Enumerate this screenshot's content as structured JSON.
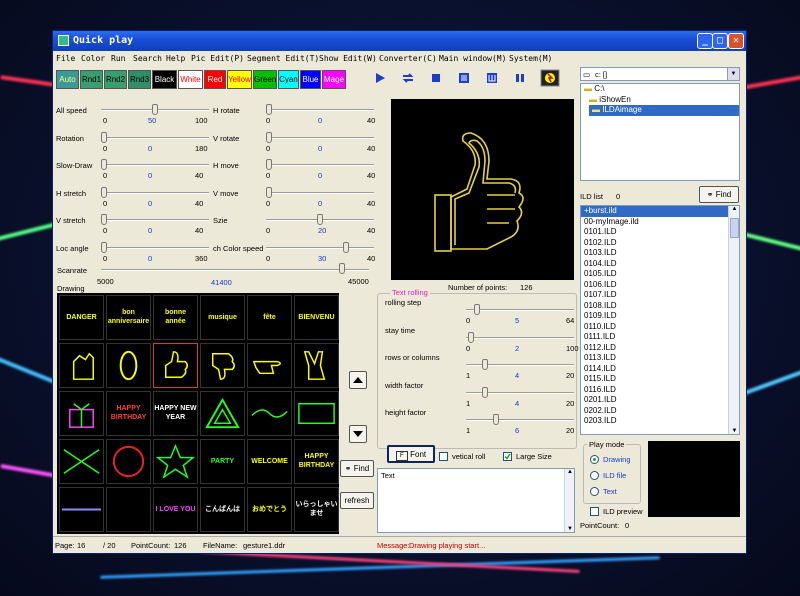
{
  "window": {
    "title": "Quick play"
  },
  "menu": [
    "File",
    "Color",
    "Run",
    "Search",
    "Help",
    "Pic Edit(P)",
    "Segment Edit(T)",
    "Show Edit(W)",
    "Converter(C)",
    "Main window(M)",
    "System(M)"
  ],
  "color_buttons": [
    {
      "label": "Auto",
      "bg": "#3a9a9a",
      "fg": "#ffff80"
    },
    {
      "label": "Rnd1",
      "bg": "#38a070",
      "fg": "#000000"
    },
    {
      "label": "Rnd2",
      "bg": "#38a070",
      "fg": "#000000"
    },
    {
      "label": "Rnd3",
      "bg": "#2f8f6a",
      "fg": "#000000"
    },
    {
      "label": "Black",
      "bg": "#000000",
      "fg": "#ffffff"
    },
    {
      "label": "White",
      "bg": "#ffffff",
      "fg": "#ff0000"
    },
    {
      "label": "Red",
      "bg": "#ff0000",
      "fg": "#ffffff"
    },
    {
      "label": "Yellow",
      "bg": "#ffff00",
      "fg": "#ff0000"
    },
    {
      "label": "Green",
      "bg": "#00c000",
      "fg": "#000000"
    },
    {
      "label": "Cyan",
      "bg": "#00ffff",
      "fg": "#000000"
    },
    {
      "label": "Blue",
      "bg": "#0000ff",
      "fg": "#ffffff"
    },
    {
      "label": "Mage",
      "bg": "#ff00ff",
      "fg": "#ffffff"
    }
  ],
  "toolbar_icons": [
    "play-icon",
    "loop-icon",
    "stop-icon",
    "segment-icon",
    "show-icon",
    "pause-icon",
    "power-icon"
  ],
  "left_sliders": [
    {
      "label": "All speed",
      "min": "0",
      "value": "50",
      "max": "100",
      "pos": 0.5
    },
    {
      "label": "Rotation",
      "min": "0",
      "value": "0",
      "max": "180",
      "pos": 0.0
    },
    {
      "label": "Slow-Draw",
      "min": "0",
      "value": "0",
      "max": "40",
      "pos": 0.0
    },
    {
      "label": "H stretch",
      "min": "0",
      "value": "0",
      "max": "40",
      "pos": 0.0
    },
    {
      "label": "V stretch",
      "min": "0",
      "value": "0",
      "max": "40",
      "pos": 0.0
    },
    {
      "label": "Loc angle",
      "min": "0",
      "value": "0",
      "max": "360",
      "pos": 0.0
    }
  ],
  "right_sliders": [
    {
      "label": "H rotate",
      "min": "0",
      "value": "0",
      "max": "40",
      "pos": 0.0
    },
    {
      "label": "V rotate",
      "min": "0",
      "value": "0",
      "max": "40",
      "pos": 0.0
    },
    {
      "label": "H move",
      "min": "0",
      "value": "0",
      "max": "40",
      "pos": 0.0
    },
    {
      "label": "V move",
      "min": "0",
      "value": "0",
      "max": "40",
      "pos": 0.0
    },
    {
      "label": "Szie",
      "min": "0",
      "value": "20",
      "max": "40",
      "pos": 0.5
    },
    {
      "label": "ch Color speed",
      "min": "0",
      "value": "30",
      "max": "40",
      "pos": 0.75
    }
  ],
  "scanrate": {
    "label": "Scanrate",
    "min": "5000",
    "value": "41400",
    "max": "45000",
    "pos": 0.91
  },
  "drawing_label": "Drawing",
  "thumbnails": [
    "DANGER",
    "bon anniversaire",
    "bonne année",
    "musique",
    "fête",
    "BIENVENU",
    "hand-icon",
    "zero-icon",
    "thumbs-up-icon",
    "thumbs-down-icon",
    "pointing-hand-icon",
    "victory-hand-icon",
    "gift-icon",
    "HAPPY BIRTHDAY",
    "HAPPY NEW YEAR",
    "triangle-icon",
    "wave-icon",
    "rectangle-icon",
    "x-curve-icon",
    "circle-icon",
    "star-icon",
    "PARTY",
    "WELCOME",
    "HAPPY BIRTHDAY",
    "line-icon",
    "blank",
    "I LOVE YOU",
    "こんばんは",
    "おめでとう",
    "いらっしゃいませ"
  ],
  "scroll_up_icon": "up-arrow-icon",
  "scroll_down_icon": "down-arrow-icon",
  "find_button": "Find",
  "refresh_button": "refresh",
  "number_of_points_label": "Number of points:",
  "number_of_points": "126",
  "text_rolling": {
    "title": "Text rolling",
    "sliders": [
      {
        "label": "rolling step",
        "min": "0",
        "value": "5",
        "max": "64",
        "pos": 0.08
      },
      {
        "label": "stay time",
        "min": "0",
        "value": "2",
        "max": "100",
        "pos": 0.02
      },
      {
        "label": "rows or columns",
        "min": "1",
        "value": "4",
        "max": "20",
        "pos": 0.16
      },
      {
        "label": "width factor",
        "min": "1",
        "value": "4",
        "max": "20",
        "pos": 0.16
      },
      {
        "label": "height factor",
        "min": "1",
        "value": "6",
        "max": "20",
        "pos": 0.26
      }
    ],
    "font_button": "Font",
    "vertical_roll": "vetical roll",
    "vertical_roll_checked": false,
    "large_size": "Large Size",
    "large_size_checked": true,
    "text_value": "Text"
  },
  "drive_select": "c: []",
  "folders": [
    "C:\\",
    "iShowEn",
    "ILDAimage"
  ],
  "ild_list_label": "ILD list",
  "ild_list_count": "0",
  "ild_find_button": "Find",
  "ild_files": [
    "+burst.ild",
    "00-myImage.ild",
    "0101.ILD",
    "0102.ILD",
    "0103.ILD",
    "0104.ILD",
    "0105.ILD",
    "0106.ILD",
    "0107.ILD",
    "0108.ILD",
    "0109.ILD",
    "0110.ILD",
    "0111.ILD",
    "0112.ILD",
    "0113.ILD",
    "0114.ILD",
    "0115.ILD",
    "0116.ILD",
    "0201.ILD",
    "0202.ILD",
    "0203.ILD"
  ],
  "play_mode": {
    "title": "Play mode",
    "options": [
      "Drawing",
      "ILD file",
      "Text"
    ],
    "selected": 0
  },
  "ild_preview": "ILD preview",
  "point_count_right_label": "PointCount:",
  "point_count_right": "0",
  "status": {
    "page_label": "Page:",
    "page": "16",
    "page_total": "/ 20",
    "point_count_label": "PointCount:",
    "point_count": "126",
    "filename_label": "FileName:",
    "filename": "gesture1.ddr",
    "message_label": "Message:",
    "message": "Drawing playing start..."
  }
}
